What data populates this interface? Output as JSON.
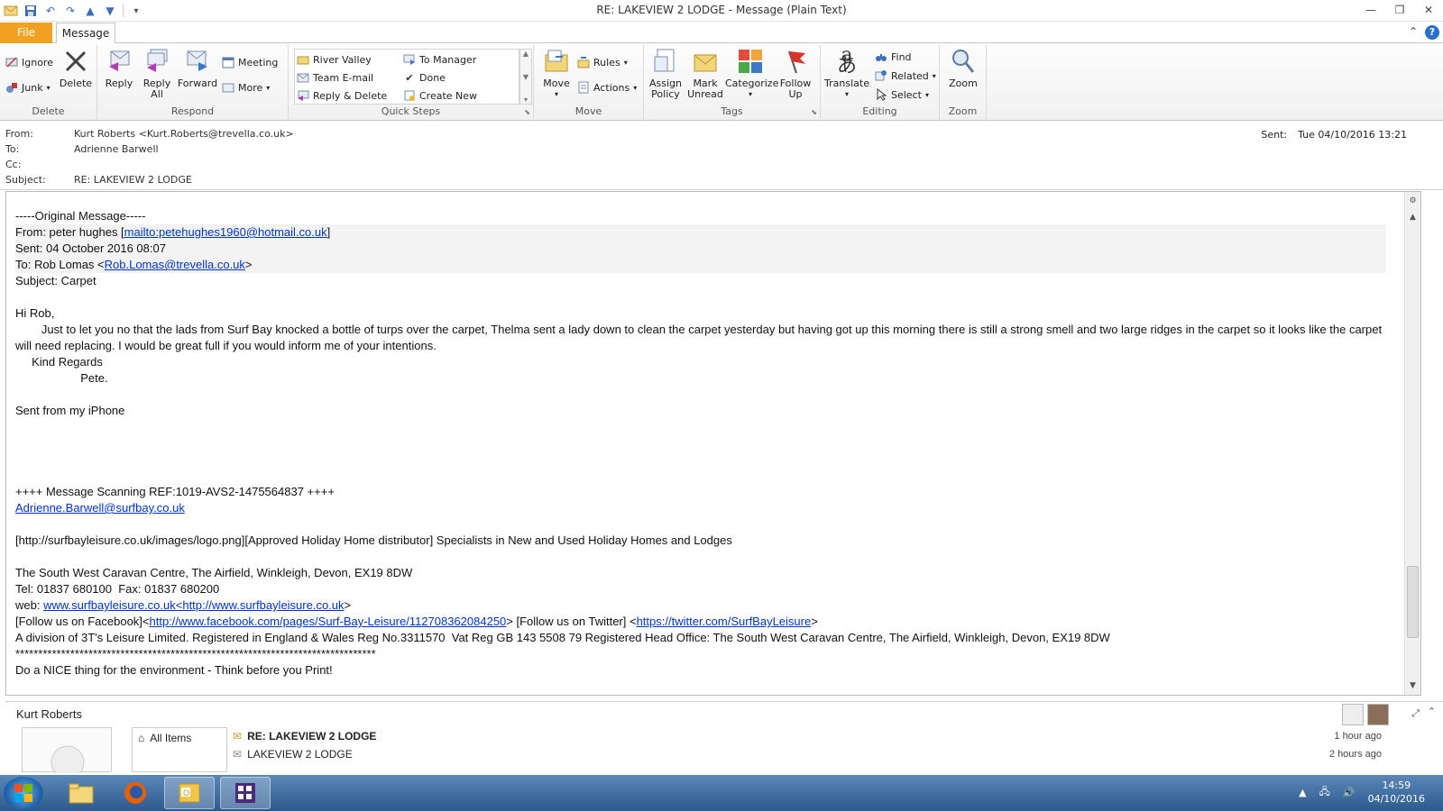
{
  "window": {
    "title": "RE: LAKEVIEW 2 LODGE  -  Message (Plain Text)"
  },
  "ribbon": {
    "tabs": {
      "file": "File",
      "message": "Message"
    },
    "delete_group": {
      "label": "Delete",
      "ignore": "Ignore",
      "junk": "Junk",
      "delete": "Delete"
    },
    "respond_group": {
      "label": "Respond",
      "reply": "Reply",
      "reply_all_1": "Reply",
      "reply_all_2": "All",
      "forward": "Forward",
      "meeting": "Meeting",
      "more": "More"
    },
    "quick_steps_group": {
      "label": "Quick Steps",
      "items": [
        "River Valley",
        "Team E-mail",
        "Reply & Delete",
        "To Manager",
        "Done",
        "Create New"
      ]
    },
    "move_group": {
      "label": "Move",
      "move": "Move",
      "rules": "Rules",
      "actions": "Actions"
    },
    "tags_group": {
      "label": "Tags",
      "assign_policy_1": "Assign",
      "assign_policy_2": "Policy",
      "mark_unread_1": "Mark",
      "mark_unread_2": "Unread",
      "categorize": "Categorize",
      "follow_up_1": "Follow",
      "follow_up_2": "Up"
    },
    "editing_group": {
      "label": "Editing",
      "translate": "Translate",
      "find": "Find",
      "related": "Related",
      "select": "Select"
    },
    "zoom_group": {
      "label": "Zoom",
      "zoom": "Zoom"
    }
  },
  "header": {
    "from_label": "From:",
    "from_value": "Kurt Roberts <Kurt.Roberts@trevella.co.uk>",
    "to_label": "To:",
    "to_value": "Adrienne Barwell",
    "cc_label": "Cc:",
    "cc_value": "",
    "subject_label": "Subject:",
    "subject_value": "RE: LAKEVIEW 2 LODGE",
    "sent_label": "Sent:",
    "sent_value": "Tue 04/10/2016 13:21"
  },
  "body": {
    "orig_header": "-----Original Message-----",
    "from_prefix": "From: peter hughes [",
    "from_link": "mailto:petehughes1960@hotmail.co.uk",
    "from_suffix": "]",
    "sent": "Sent: 04 October 2016 08:07",
    "to_prefix": "To: Rob Lomas <",
    "to_link": "Rob.Lomas@trevella.co.uk",
    "to_suffix": ">",
    "subject": "Subject: Carpet",
    "greeting": "Hi Rob,",
    "para": "        Just to let you no that the lads from Surf Bay knocked a bottle of turps over the carpet, Thelma sent a lady down to clean the carpet yesterday but having got up this morning there is still a strong smell and two large ridges in the carpet so it looks like the carpet will need replacing. I would be great full if you would inform me of your intentions.",
    "regards": "     Kind Regards",
    "name": "                    Pete.",
    "iphone": "Sent from my iPhone",
    "scanning": "++++ Message Scanning REF:1019-AVS2-1475564837 ++++",
    "adrienne_link": "Adrienne.Barwell@surfbay.co.uk",
    "logo_line": "[http://surfbayleisure.co.uk/images/logo.png][Approved Holiday Home distributor] Specialists in New and Used Holiday Homes and Lodges",
    "address": "The South West Caravan Centre, The Airfield, Winkleigh, Devon, EX19 8DW",
    "tel": "Tel: 01837 680100  Fax: 01837 680200",
    "web_prefix": "web: ",
    "web_link1": "www.surfbayleisure.co.uk",
    "web_link2": "<http://www.surfbayleisure.co.uk",
    "web_suffix": ">",
    "fb_prefix": "[Follow us on Facebook]<",
    "fb_link": "http://www.facebook.com/pages/Surf-Bay-Leisure/112708362084250",
    "fb_mid": "> [Follow us on Twitter] <",
    "tw_link": "https://twitter.com/SurfBayLeisure",
    "tw_suffix": ">",
    "division": "A division of 3T's Leisure Limited. Registered in England & Wales Reg No.3311570  Vat Reg GB 143 5508 79 Registered Head Office: The South West Caravan Centre, The Airfield, Winkleigh, Devon, EX19 8DW",
    "stars": "*******************************************************************************",
    "nice": "Do a NICE thing for the environment - Think before you Print!"
  },
  "people_pane": {
    "name": "Kurt Roberts",
    "nav_all_items": "All Items",
    "items": [
      {
        "subject": "RE: LAKEVIEW 2 LODGE",
        "time": "1 hour ago"
      },
      {
        "subject": "LAKEVIEW 2 LODGE",
        "time": "2 hours ago"
      }
    ]
  },
  "taskbar": {
    "time": "14:59",
    "date": "04/10/2016"
  },
  "colors": {
    "file_tab": "#f1a121",
    "link": "#0033cc",
    "taskbar": "#2d5a8e"
  }
}
